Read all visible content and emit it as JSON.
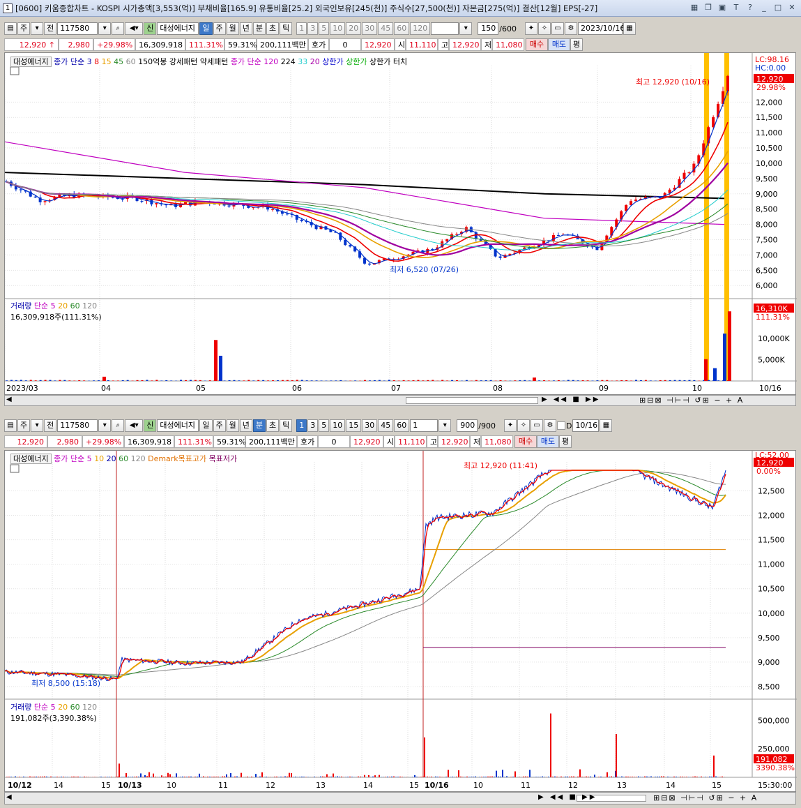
{
  "window": {
    "num": "1",
    "title": "[0600] 키움종합차트 - KOSPI 시가총액[3,553(억)] 부채비율[165.9] 유통비율[25.2] 외국인보유[245(천)] 주식수[27,500(천)] 자본금[275(억)] 결산[12월] EPS[-27]"
  },
  "top": {
    "toolbar": {
      "type": "주",
      "prev": "전",
      "code": "117580",
      "sin": "신",
      "name": "대성에너지",
      "periods": [
        "일",
        "주",
        "월",
        "년",
        "분",
        "초",
        "틱"
      ],
      "active_period": "일",
      "nums": [
        "1",
        "3",
        "5",
        "10",
        "20",
        "30",
        "45",
        "60",
        "120"
      ],
      "count": "150",
      "total": "/600",
      "date": "2023/10/16"
    },
    "price": {
      "last": "12,920",
      "arrow": "↑",
      "change": "2,980",
      "pct": "+29.98%",
      "volume": "16,309,918",
      "vol_pct": "111.31%",
      "turn": "59.31%",
      "amount": "200,111백만",
      "hoga_lbl": "호가",
      "hoga": "0",
      "hoga_price": "12,920",
      "open_lbl": "시",
      "open": "11,110",
      "high_lbl": "고",
      "high": "12,920",
      "low_lbl": "저",
      "low": "11,080",
      "buy": "매수",
      "sell": "매도",
      "flat": "평"
    },
    "legend": {
      "name": "대성에너지",
      "ma": "종가 단순",
      "p3": "3",
      "p8": "8",
      "p15": "15",
      "p45": "45",
      "p60": "60",
      "l1": "150억봉",
      "l2": "강세패턴",
      "l3": "약세패턴",
      "ma2": "종가 단순",
      "p120": "120",
      "p224": "224",
      "p33": "33",
      "p20": "20",
      "u1": "상한가",
      "u2": "상한가",
      "u3": "상한가 터치"
    },
    "lc": "LC:98.16",
    "hc": "HC:0.00",
    "price_tag": "12,920",
    "pct_tag": "29.98%",
    "yaxis": [
      "12,000",
      "11,500",
      "11,000",
      "10,500",
      "10,000",
      "9,500",
      "9,000",
      "8,500",
      "8,000",
      "7,500",
      "7,000",
      "6,500",
      "6,000"
    ],
    "high_ann": "최고 12,920 (10/16)",
    "low_ann": "최저 6,520 (07/26)",
    "vol_legend": {
      "name": "거래량",
      "ma": "단순",
      "p5": "5",
      "p20": "20",
      "p60": "60",
      "p120": "120"
    },
    "vol_text": "16,309,918주(111.31%)",
    "vol_tag": "16,310K",
    "vol_pct_tag": "111.31%",
    "vol_axis": [
      "10,000K",
      "5,000K"
    ],
    "xaxis": [
      "2023/03",
      "04",
      "05",
      "06",
      "07",
      "08",
      "09",
      "10",
      "10/16"
    ]
  },
  "bottom": {
    "toolbar": {
      "type": "주",
      "prev": "전",
      "code": "117580",
      "sin": "신",
      "name": "대성에너지",
      "periods": [
        "일",
        "주",
        "월",
        "년",
        "분",
        "초",
        "틱"
      ],
      "active_period": "분",
      "nums": [
        "1",
        "3",
        "5",
        "10",
        "15",
        "30",
        "45",
        "60"
      ],
      "num_sel": "1",
      "count": "900",
      "total": "/900",
      "d": "D",
      "date": "10/16"
    },
    "price": {
      "last": "12,920",
      "change": "2,980",
      "pct": "+29.98%",
      "volume": "16,309,918",
      "vol_pct": "111.31%",
      "turn": "59.31%",
      "amount": "200,111백만",
      "hoga_lbl": "호가",
      "hoga": "0",
      "hoga_price": "12,920",
      "open_lbl": "시",
      "open": "11,110",
      "high_lbl": "고",
      "high": "12,920",
      "low_lbl": "저",
      "low": "11,080",
      "buy": "매수",
      "sell": "매도",
      "flat": "평"
    },
    "legend": {
      "name": "대성에너지",
      "ma": "종가 단순",
      "p5": "5",
      "p10": "10",
      "p20": "20",
      "p60": "60",
      "p120": "120",
      "d1": "Demark목표고가",
      "d2": "목표저가"
    },
    "lc": "LC:52.00",
    "price_tag": "12,920",
    "pct_tag": "0.00%",
    "yaxis": [
      "12,500",
      "12,000",
      "11,500",
      "11,000",
      "10,500",
      "10,000",
      "9,500",
      "9,000",
      "8,500"
    ],
    "high_ann": "최고 12,920 (11:41)",
    "low_ann": "최저 8,500 (15:18)",
    "vol_legend": {
      "name": "거래량",
      "ma": "단순",
      "p5": "5",
      "p20": "20",
      "p60": "60",
      "p120": "120"
    },
    "vol_text": "191,082주(3,390.38%)",
    "vol_tag": "191,082",
    "vol_pct_tag": "3390.38%",
    "vol_axis": [
      "500,000",
      "250,000"
    ],
    "xaxis": [
      "10/12",
      "14",
      "15",
      "10/13",
      "10",
      "11",
      "12",
      "13",
      "14",
      "15",
      "10/16",
      "10",
      "11",
      "12",
      "13",
      "14",
      "15",
      "15:30:00"
    ]
  },
  "chart_data": [
    {
      "type": "candlestick",
      "title": "대성에너지 일봉",
      "x_range": [
        "2023/03",
        "2023/10/16"
      ],
      "ylim": [
        5800,
        12920
      ],
      "high": {
        "value": 12920,
        "date": "10/16"
      },
      "low": {
        "value": 6520,
        "date": "07/26"
      },
      "close_series": {
        "x": [
          "03/01",
          "03/15",
          "04/01",
          "04/15",
          "05/01",
          "05/09",
          "05/15",
          "06/01",
          "06/15",
          "07/01",
          "07/15",
          "07/26",
          "08/01",
          "08/15",
          "08/21",
          "09/01",
          "09/15",
          "10/01",
          "10/10",
          "10/11",
          "10/12",
          "10/13",
          "10/16"
        ],
        "values": [
          9400,
          8800,
          8950,
          8900,
          8850,
          8600,
          8750,
          8650,
          8550,
          8100,
          7700,
          6700,
          6950,
          7200,
          7900,
          6900,
          7300,
          7700,
          7200,
          8800,
          8900,
          9940,
          12920
        ]
      },
      "ma224": {
        "x": [
          "03/01",
          "05/01",
          "07/01",
          "09/01",
          "10/16"
        ],
        "values": [
          9700,
          9500,
          9300,
          9000,
          8850
        ]
      },
      "ma120": {
        "x": [
          "03/01",
          "05/01",
          "07/01",
          "09/01",
          "10/16"
        ],
        "values": [
          10700,
          9700,
          9200,
          8200,
          8000
        ]
      },
      "volume": {
        "unit": "K",
        "x": [
          "04/05",
          "05/09",
          "05/10",
          "08/21",
          "10/11",
          "10/12",
          "10/13",
          "10/16"
        ],
        "values": [
          1000,
          9600,
          5900,
          800,
          5100,
          3000,
          11100,
          16310
        ]
      }
    },
    {
      "type": "line",
      "title": "대성에너지 1분봉",
      "x_range": [
        "10/12",
        "10/16 15:30"
      ],
      "ylim": [
        8300,
        12920
      ],
      "high": {
        "value": 12920,
        "time": "11:41"
      },
      "low": {
        "value": 8500,
        "time": "15:18"
      },
      "demark": {
        "high": 11300,
        "low": 9300
      },
      "close_series": {
        "x": [
          "10/12 09:00",
          "10/12 12:00",
          "10/12 15:18",
          "10/13 09:05",
          "10/13 11:00",
          "10/13 13:00",
          "10/13 14:00",
          "10/13 15:00",
          "10/13 15:20",
          "10/16 09:00",
          "10/16 09:30",
          "10/16 10:30",
          "10/16 11:41",
          "10/16 14:30",
          "10/16 15:00",
          "10/16 15:20"
        ],
        "values": [
          8800,
          8750,
          8650,
          9050,
          8980,
          9000,
          9850,
          10200,
          10500,
          11800,
          11950,
          12050,
          12920,
          12920,
          12150,
          12920
        ]
      },
      "volume": {
        "x": [
          "10/13 09:01",
          "10/16 09:00",
          "10/16 11:41",
          "10/16 13:30",
          "10/16 15:15"
        ],
        "values": [
          120000,
          350000,
          560000,
          380000,
          191082
        ]
      }
    }
  ]
}
